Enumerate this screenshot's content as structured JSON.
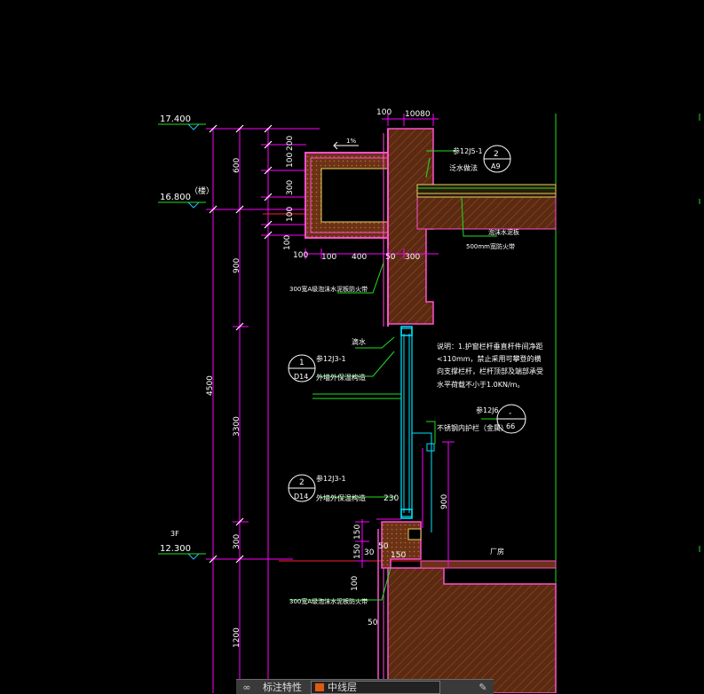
{
  "levels": {
    "l1": "17.400",
    "l2": "16.800",
    "l2_note": "（楼）",
    "l3_floor": "3F",
    "l3": "12.300"
  },
  "dims_left": {
    "d600a": "600",
    "d900a": "900",
    "d4500": "4500",
    "d3300": "3300",
    "d300a": "300",
    "d1200": "1200"
  },
  "dims_parapet": {
    "d200": "200",
    "d100a": "100",
    "d300b": "300",
    "d100b": "100",
    "d100c": "100",
    "d100d": "100",
    "d100e": "100",
    "d400": "400",
    "d50a": "50",
    "d300c": "300",
    "top100": "100",
    "top10080": "10080",
    "slope": "1%"
  },
  "dims_sill": {
    "d150a": "150",
    "d150b": "150",
    "d30": "30",
    "d50b": "50",
    "d150c": "150",
    "d230": "230",
    "d100f": "100",
    "d50c": "50",
    "d900b": "900"
  },
  "refs": {
    "r1_text": "参12J5-1",
    "r1_num": "2",
    "r1_sheet": "A9",
    "r1_desc": "泛水做法",
    "r2_text": "参12J3-1",
    "r2_num": "1",
    "r2_sheet": "D14",
    "r2_desc": "外墙外保温构造",
    "r3_text": "参12J6",
    "r3_num": "-",
    "r3_sheet": "66",
    "r3_desc": "不锈钢内护栏（金属）",
    "r4_text": "参12J3-1",
    "r4_num": "2",
    "r4_sheet": "D14",
    "r4_desc": "外墙外保温构造"
  },
  "notes": {
    "roof_note1": "泡沫水泥板",
    "roof_note2": "500mm宽防火带",
    "drip": "滴水",
    "insul_top": "300宽A级泡沫水泥板防火带",
    "insul_bottom": "300宽A级泡沫水泥板防火带",
    "room": "厂房",
    "desc1": "说明：1.护窗栏杆垂直杆件间净距",
    "desc2": "<110mm，禁止采用可攀登的横",
    "desc3": "向支撑栏杆，栏杆顶部及端部承受",
    "desc4": "水平荷载不小于1.0KN/m。"
  },
  "statusbar": {
    "label": "标注特性",
    "layer": "中线层"
  },
  "colors": {
    "background": "#000000",
    "dimension": "#ff00ff",
    "wall": "#ff4fd0",
    "leader": "#20e020",
    "concrete_fill": "#6b3215",
    "insulation": "#e8d060",
    "window": "#00e5ff",
    "text": "#ffffff",
    "level_mark": "#22c0ff",
    "axis_red": "#ff2020"
  }
}
